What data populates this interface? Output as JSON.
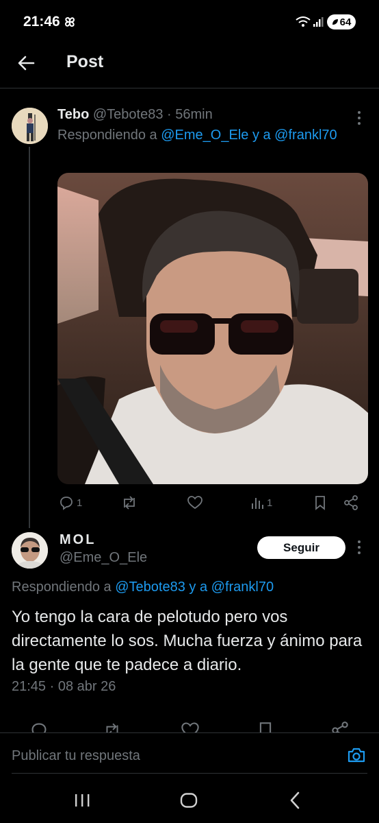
{
  "status_bar": {
    "time": "21:46",
    "battery": "64"
  },
  "header": {
    "title": "Post"
  },
  "reply_tweet": {
    "display_name": "Tebo",
    "handle": "@Tebote83",
    "time_ago": "· 56min",
    "replying_prefix": "Respondiendo a",
    "replying_targets": "@Eme_O_Ele y a @frankl70",
    "actions": {
      "replies": "1",
      "views": "1"
    }
  },
  "main_tweet": {
    "display_name": "MOL",
    "handle": "@Eme_O_Ele",
    "follow_label": "Seguir",
    "replying_prefix": "Respondiendo a",
    "replying_targets": "@Tebote83 y a @frankl70",
    "text": "Yo tengo la cara de pelotudo pero vos directamente lo sos. Mucha fuerza y ánimo para la gente que te padece a diario.",
    "timestamp": "21:45 · 08 abr 26"
  },
  "composer": {
    "placeholder": "Publicar tu respuesta"
  },
  "colors": {
    "accent": "#1d9bf0",
    "background": "#000000",
    "text": "#e7e9ea",
    "muted": "#71767b"
  }
}
